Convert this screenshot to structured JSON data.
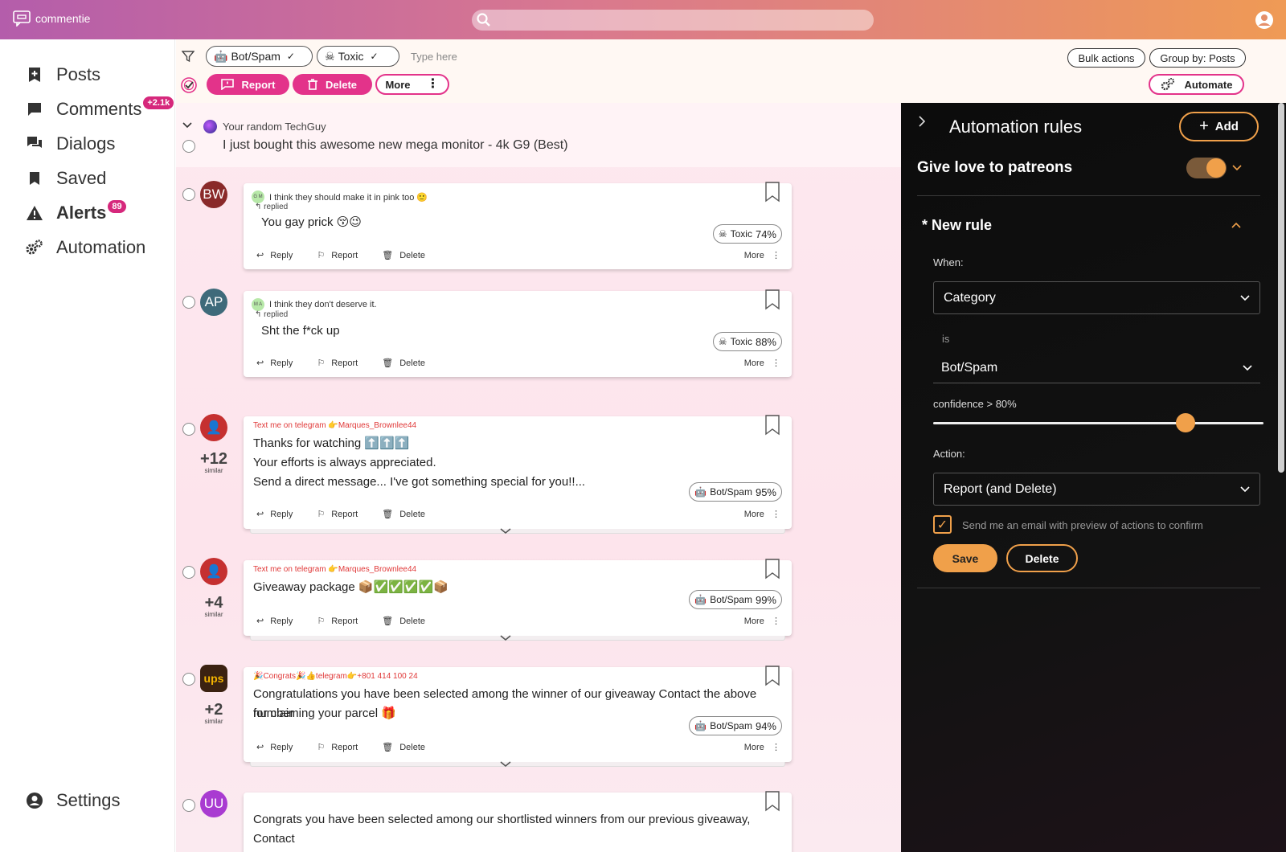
{
  "app": {
    "name": "commentie"
  },
  "search": {
    "placeholder": ""
  },
  "sidebar": {
    "items": [
      {
        "label": "Posts"
      },
      {
        "label": "Comments",
        "badge": "+2.1k"
      },
      {
        "label": "Dialogs"
      },
      {
        "label": "Saved"
      },
      {
        "label": "Alerts",
        "badge": "89"
      },
      {
        "label": "Automation"
      }
    ],
    "settings": "Settings"
  },
  "toolbar": {
    "filters": [
      "Bot/Spam",
      "Toxic"
    ],
    "type_placeholder": "Type here",
    "bulk_actions": "Bulk actions",
    "group_by": "Group by: Posts",
    "report": "Report",
    "delete": "Delete",
    "more": "More",
    "automate": "Automate"
  },
  "post": {
    "author": "Your random TechGuy",
    "title": "I just bought this awesome new mega monitor - 4k G9 (Best)"
  },
  "comments": [
    {
      "initials": "BW",
      "context_initials": "G M",
      "context": "I think they should make it in pink too 🙂",
      "replied": "replied",
      "lines": [
        "You gay prick 😚😉"
      ],
      "tag": "Toxic",
      "pct": "74%"
    },
    {
      "initials": "AP",
      "context_initials": "M A",
      "context": "I think they don't deserve it.",
      "replied": "replied",
      "lines": [
        "Sht the f*ck up"
      ],
      "tag": "Toxic",
      "pct": "88%"
    },
    {
      "similar": "+12",
      "similar_label": "similar",
      "spam_header": "Text me on telegram 👉Marques_Brownlee44",
      "lines": [
        "Thanks for watching ⬆️⬆️⬆️",
        "Your efforts is always appreciated.",
        "Send a direct message... I've got something special for you!!..."
      ],
      "tag": "Bot/Spam",
      "pct": "95%"
    },
    {
      "similar": "+4",
      "similar_label": "similar",
      "spam_header": "Text me on telegram 👉Marques_Brownlee44",
      "lines": [
        "Giveaway package 📦✅✅✅✅📦"
      ],
      "tag": "Bot/Spam",
      "pct": "99%"
    },
    {
      "avatar_text": "ups",
      "similar": "+2",
      "similar_label": "similar",
      "spam_header": "🎉Congrats🎉👍telegram👉+801 414 100 24",
      "lines": [
        "Congratulations you have been selected among the winner of our giveaway Contact the above number",
        "for claiming your parcel 🎁"
      ],
      "tag": "Bot/Spam",
      "pct": "94%"
    },
    {
      "initials": "UU",
      "lines": [
        "Congrats you have been selected among our shortlisted winners from our previous giveaway, Contact"
      ]
    }
  ],
  "actions": {
    "reply": "Reply",
    "report": "Report",
    "delete": "Delete",
    "more": "More"
  },
  "panel": {
    "title": "Automation rules",
    "add": "Add",
    "rule_name": "Give love to patreons",
    "new_rule": "* New rule",
    "when": "When:",
    "category": "Category",
    "is": "is",
    "value": "Bot/Spam",
    "confidence": "confidence > 80%",
    "confidence_value": 80,
    "action_label": "Action:",
    "action": "Report (and Delete)",
    "email": "Send me an email with preview of actions to confirm",
    "save": "Save",
    "delete": "Delete"
  },
  "colors": {
    "accent": "#e3338a",
    "orange": "#f0a04a",
    "spam_red": "#e03838"
  }
}
